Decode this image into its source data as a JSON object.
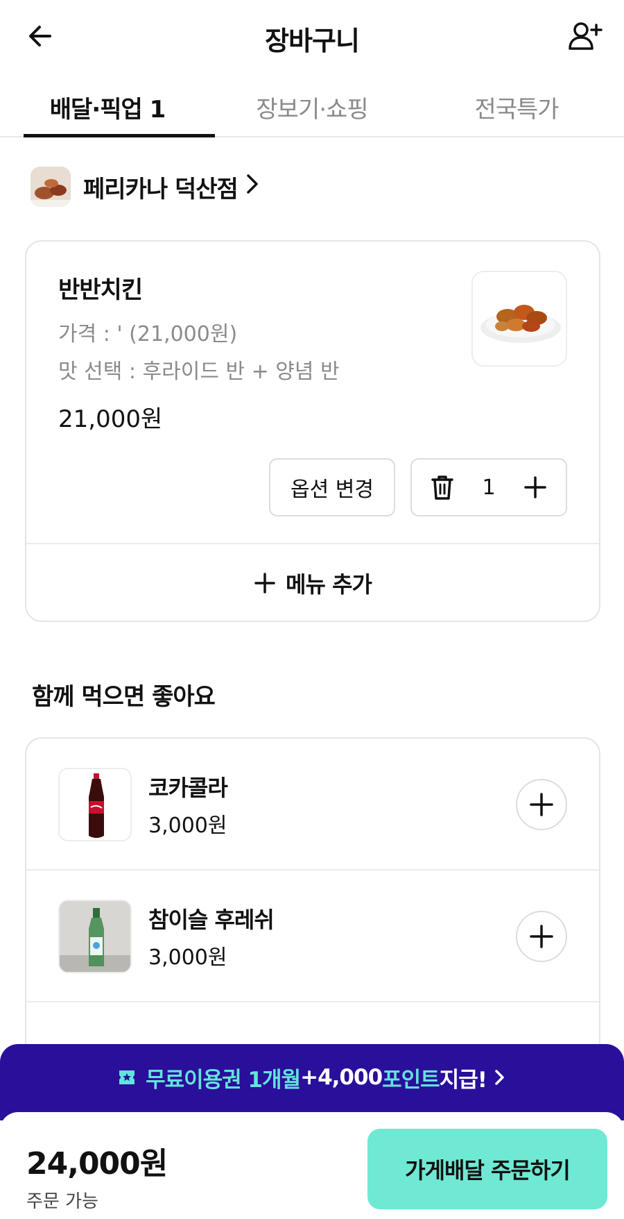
{
  "header": {
    "title": "장바구니",
    "back_icon": "arrow-left-icon",
    "invite_icon": "add-person-icon"
  },
  "tabs": [
    {
      "label": "배달·픽업 1",
      "active": true
    },
    {
      "label": "장보기·쇼핑",
      "active": false
    },
    {
      "label": "전국특가",
      "active": false
    }
  ],
  "store": {
    "name": "페리카나 덕산점",
    "chevron": "›"
  },
  "cart": {
    "item": {
      "name": "반반치킨",
      "option_price": "가격 : ' (21,000원)",
      "option_taste": "맛 선택 : 후라이드 반 + 양념 반",
      "price": "21,000원",
      "quantity": "1"
    },
    "change_option_label": "옵션 변경",
    "add_menu_label": "메뉴 추가"
  },
  "recommend": {
    "title": "함께 먹으면 좋아요",
    "items": [
      {
        "name": "코카콜라",
        "price": "3,000원"
      },
      {
        "name": "참이슬 후레쉬",
        "price": "3,000원"
      }
    ]
  },
  "promo": {
    "part1": "무료이용권 1개월",
    "part2": "+4,000",
    "part3": " 포인트",
    "part4": " 지급!",
    "chevron": "›"
  },
  "bottom": {
    "total": "24,000원",
    "status": "주문 가능",
    "order_label": "가게배달 주문하기"
  },
  "colors": {
    "promo_bg": "#2a0f9a",
    "promo_accent": "#63e3dd",
    "order_button": "#6fe9d3"
  }
}
